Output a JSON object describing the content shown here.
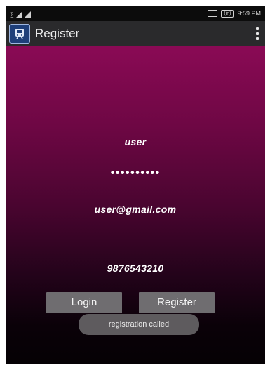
{
  "status_bar": {
    "signal_label": "∑",
    "battery_text": "(in)",
    "time": "9:59 PM"
  },
  "action_bar": {
    "title": "Register",
    "app_icon": "train-icon",
    "menu_icon": "overflow-menu-icon"
  },
  "form": {
    "username": "user",
    "password_mask": "••••••••••",
    "email": "user@gmail.com",
    "phone": "9876543210"
  },
  "buttons": {
    "login_label": "Login",
    "register_label": "Register"
  },
  "toast": {
    "message": "registration called"
  },
  "colors": {
    "background_top": "#8a0a55",
    "background_bottom": "#050104",
    "action_bar": "#2a2a2c",
    "button": "#6f6d70"
  }
}
